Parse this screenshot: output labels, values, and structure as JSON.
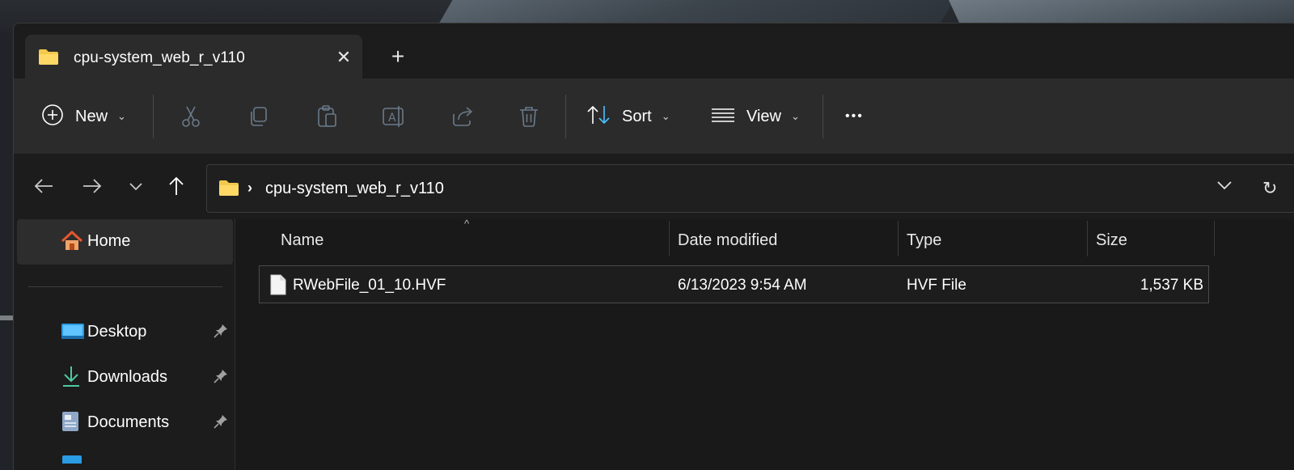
{
  "tab": {
    "title": "cpu-system_web_r_v110",
    "close_glyph": "✕",
    "new_tab_glyph": "+"
  },
  "toolbar": {
    "new_label": "New",
    "sort_label": "Sort",
    "view_label": "View",
    "more_glyph": "•••",
    "icons": [
      "plus-circle-icon",
      "cut-icon",
      "copy-icon",
      "paste-icon",
      "rename-icon",
      "share-icon",
      "delete-icon",
      "sort-icon",
      "view-lines-icon",
      "more-icon"
    ]
  },
  "address": {
    "separator": "›",
    "path": "cpu-system_web_r_v110"
  },
  "sidebar": {
    "items": [
      {
        "label": "Home",
        "icon": "home-icon"
      },
      {
        "label": "Desktop",
        "icon": "desktop-icon",
        "pinned": true
      },
      {
        "label": "Downloads",
        "icon": "download-icon",
        "pinned": true
      },
      {
        "label": "Documents",
        "icon": "documents-icon",
        "pinned": true
      }
    ]
  },
  "columns": {
    "name": "Name",
    "date_modified": "Date modified",
    "type": "Type",
    "size": "Size"
  },
  "files": [
    {
      "name": "RWebFile_01_10.HVF",
      "date_modified": "6/13/2023 9:54 AM",
      "type": "HVF File",
      "size": "1,537 KB"
    }
  ],
  "colors": {
    "folder_yellow": "#f3c94b",
    "accent_blue": "#4cc2ff",
    "download_green": "#4ec9a0",
    "window_bg": "#191919",
    "toolbar_bg": "#2b2b2b"
  }
}
